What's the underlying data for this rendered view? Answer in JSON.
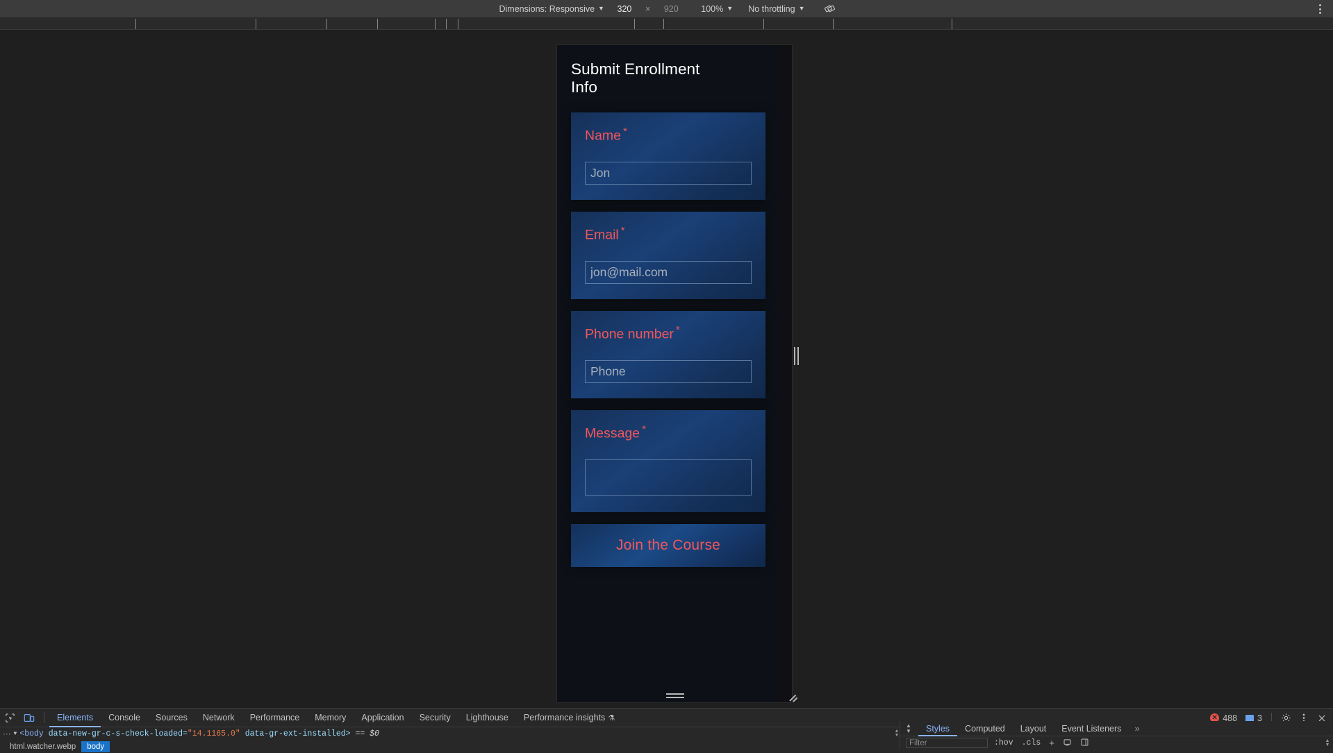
{
  "device_toolbar": {
    "dimensions_label": "Dimensions: Responsive",
    "width_value": "320",
    "times": "×",
    "height_value": "920",
    "zoom_label": "100%",
    "throttling_label": "No throttling",
    "rotate_icon": "rotate-device-icon",
    "kebab_icon": "more-options-icon"
  },
  "ruler": {
    "tick_positions": [
      195,
      368,
      470,
      543,
      626,
      642,
      659,
      913,
      955,
      1099,
      1199,
      1370
    ]
  },
  "page": {
    "title": "Submit Enrollment Info",
    "fields": [
      {
        "label": "Name",
        "required_mark": "*",
        "placeholder": "Jon",
        "value": "",
        "type": "text",
        "name": "name"
      },
      {
        "label": "Email",
        "required_mark": "*",
        "placeholder": "jon@mail.com",
        "value": "",
        "type": "email",
        "name": "email"
      },
      {
        "label": "Phone number",
        "required_mark": "*",
        "placeholder": "Phone",
        "value": "",
        "type": "tel",
        "name": "phone"
      },
      {
        "label": "Message",
        "required_mark": "*",
        "placeholder": "",
        "value": "",
        "type": "textarea",
        "name": "message"
      }
    ],
    "submit_label": "Join the Course",
    "colors": {
      "background": "#0d1117",
      "card_blue": "#1a4077",
      "accent_red": "#f2565c",
      "title_white": "#ffffff",
      "placeholder_gray": "#a8b0ba"
    }
  },
  "devtools": {
    "inspect_icon": "inspect-element-icon",
    "device_toggle_icon": "device-toolbar-icon",
    "tabs": [
      {
        "label": "Elements",
        "active": true
      },
      {
        "label": "Console",
        "active": false
      },
      {
        "label": "Sources",
        "active": false
      },
      {
        "label": "Network",
        "active": false
      },
      {
        "label": "Performance",
        "active": false
      },
      {
        "label": "Memory",
        "active": false
      },
      {
        "label": "Application",
        "active": false
      },
      {
        "label": "Security",
        "active": false
      },
      {
        "label": "Lighthouse",
        "active": false
      },
      {
        "label": "Performance insights",
        "active": false,
        "flask": "⚗"
      }
    ],
    "error_count": "488",
    "message_count": "3",
    "gear_icon": "settings-gear-icon",
    "kebab_icon": "more-tools-icon",
    "close_icon": "close-devtools-icon",
    "dom_line": {
      "dots": "⋯",
      "triangle": "▼",
      "open": "<body",
      "attr1_name": "data-new-gr-c-s-check-loaded=",
      "attr1_value": "\"14.1165.0\"",
      "attr2_name": "data-gr-ext-installed>",
      "equals": "==",
      "dollar": "$0"
    },
    "crumbs": [
      {
        "label": "html.watcher.webp",
        "selected": false
      },
      {
        "label": "body",
        "selected": true
      }
    ],
    "styles_tabs": [
      {
        "label": "Styles",
        "active": true
      },
      {
        "label": "Computed",
        "active": false
      },
      {
        "label": "Layout",
        "active": false
      },
      {
        "label": "Event Listeners",
        "active": false
      }
    ],
    "styles_more": "»",
    "filter_placeholder": "Filter",
    "hov_label": ":hov",
    "cls_label": ".cls",
    "plus_label": "+",
    "new_style_rule_icon": "new-style-rule-icon",
    "toggle_sidebar_icon": "toggle-element-sidebar-icon"
  }
}
